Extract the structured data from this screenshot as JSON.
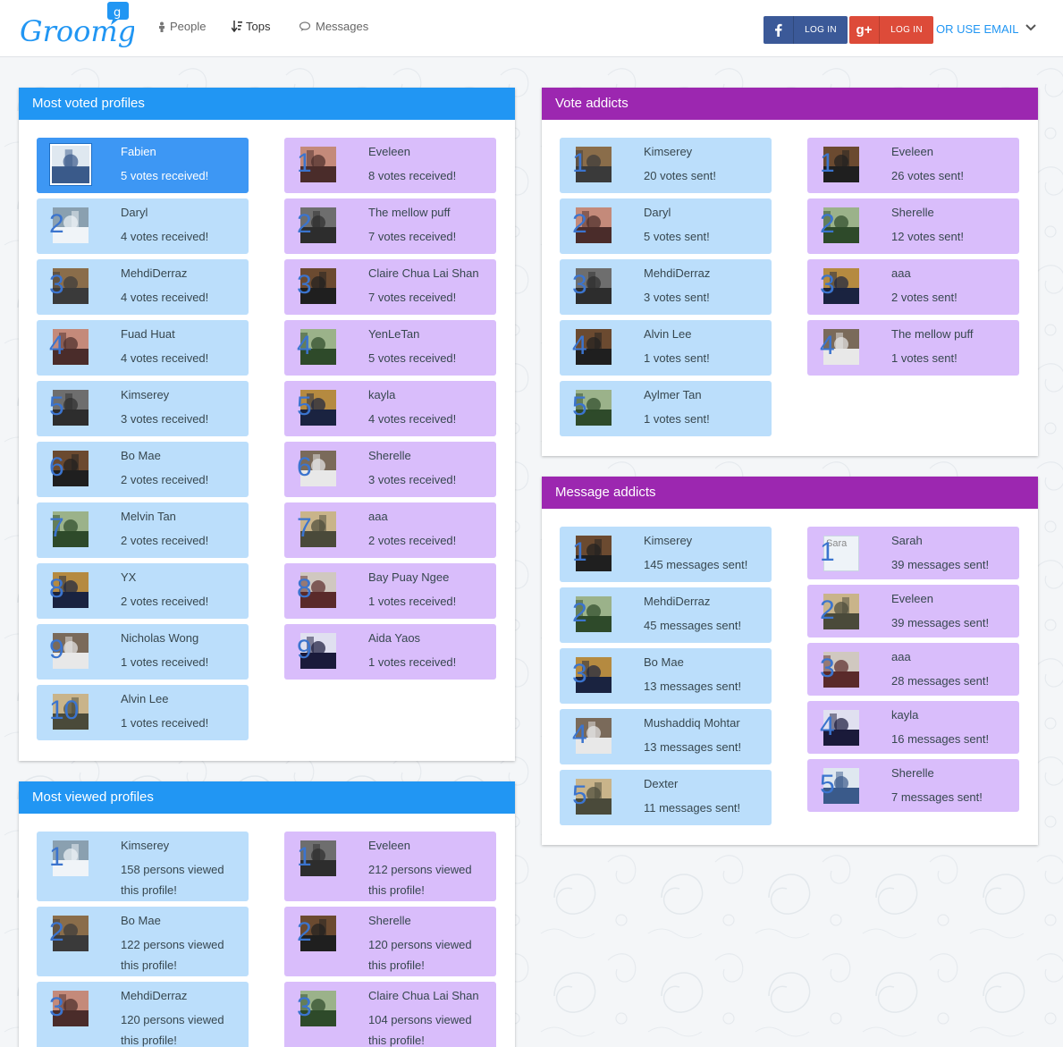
{
  "colors": {
    "blue": "#2196f3",
    "purple": "#9c27b0",
    "card_blue": "#bbdefb",
    "card_purple": "#d9bdfb",
    "selected": "#3d97f4"
  },
  "header": {
    "logo_text": "Groomgy",
    "nav": [
      {
        "label": "People",
        "icon": "person-icon"
      },
      {
        "label": "Tops",
        "icon": "sort-icon"
      },
      {
        "label": "Messages",
        "icon": "chat-icon"
      }
    ],
    "facebook_login": "LOG IN",
    "google_login": "LOG IN",
    "email_link": "OR USE EMAIL"
  },
  "most_voted": {
    "title": "Most voted profiles",
    "left": [
      {
        "rank": "1",
        "name": "Fabien",
        "count": "5 votes received!",
        "selected": true
      },
      {
        "rank": "2",
        "name": "Daryl",
        "count": "4 votes received!"
      },
      {
        "rank": "3",
        "name": "MehdiDerraz",
        "count": "4 votes received!"
      },
      {
        "rank": "4",
        "name": "Fuad Huat",
        "count": "4 votes received!"
      },
      {
        "rank": "5",
        "name": "Kimserey",
        "count": "3 votes received!"
      },
      {
        "rank": "6",
        "name": "Bo Mae",
        "count": "2 votes received!"
      },
      {
        "rank": "7",
        "name": "Melvin Tan",
        "count": "2 votes received!"
      },
      {
        "rank": "8",
        "name": "YX",
        "count": "2 votes received!"
      },
      {
        "rank": "9",
        "name": "Nicholas Wong",
        "count": "1 votes received!"
      },
      {
        "rank": "10",
        "name": "Alvin Lee",
        "count": "1 votes received!"
      }
    ],
    "right": [
      {
        "rank": "1",
        "name": "Eveleen",
        "count": "8 votes received!"
      },
      {
        "rank": "2",
        "name": "The mellow puff",
        "count": "7 votes received!"
      },
      {
        "rank": "3",
        "name": "Claire Chua Lai Shan",
        "count": "7 votes received!"
      },
      {
        "rank": "4",
        "name": "YenLeTan",
        "count": "5 votes received!"
      },
      {
        "rank": "5",
        "name": "kayla",
        "count": "4 votes received!"
      },
      {
        "rank": "6",
        "name": "Sherelle",
        "count": "3 votes received!"
      },
      {
        "rank": "7",
        "name": "aaa",
        "count": "2 votes received!"
      },
      {
        "rank": "8",
        "name": "Bay Puay Ngee",
        "count": "1 votes received!"
      },
      {
        "rank": "9",
        "name": "Aida Yaos",
        "count": "1 votes received!"
      }
    ]
  },
  "vote_addicts": {
    "title": "Vote addicts",
    "left": [
      {
        "rank": "1",
        "name": "Kimserey",
        "count": "20 votes sent!"
      },
      {
        "rank": "2",
        "name": "Daryl",
        "count": "5 votes sent!"
      },
      {
        "rank": "3",
        "name": "MehdiDerraz",
        "count": "3 votes sent!"
      },
      {
        "rank": "4",
        "name": "Alvin Lee",
        "count": "1 votes sent!"
      },
      {
        "rank": "5",
        "name": "Aylmer Tan",
        "count": "1 votes sent!"
      }
    ],
    "right": [
      {
        "rank": "1",
        "name": "Eveleen",
        "count": "26 votes sent!"
      },
      {
        "rank": "2",
        "name": "Sherelle",
        "count": "12 votes sent!"
      },
      {
        "rank": "3",
        "name": "aaa",
        "count": "2 votes sent!"
      },
      {
        "rank": "4",
        "name": "The mellow puff",
        "count": "1 votes sent!"
      }
    ]
  },
  "message_addicts": {
    "title": "Message addicts",
    "left": [
      {
        "rank": "1",
        "name": "Kimserey",
        "count": "145 messages sent!"
      },
      {
        "rank": "2",
        "name": "MehdiDerraz",
        "count": "45 messages sent!"
      },
      {
        "rank": "3",
        "name": "Bo Mae",
        "count": "13 messages sent!"
      },
      {
        "rank": "4",
        "name": "Mushaddiq Mohtar",
        "count": "13 messages sent!"
      },
      {
        "rank": "5",
        "name": "Dexter",
        "count": "11 messages sent!"
      }
    ],
    "right": [
      {
        "rank": "1",
        "name": "Sarah",
        "count": "39 messages sent!",
        "alt": "Sara"
      },
      {
        "rank": "2",
        "name": "Eveleen",
        "count": "39 messages sent!"
      },
      {
        "rank": "3",
        "name": "aaa",
        "count": "28 messages sent!"
      },
      {
        "rank": "4",
        "name": "kayla",
        "count": "16 messages sent!"
      },
      {
        "rank": "5",
        "name": "Sherelle",
        "count": "7 messages sent!"
      }
    ]
  },
  "most_viewed": {
    "title": "Most viewed profiles",
    "left": [
      {
        "rank": "1",
        "name": "Kimserey",
        "count": "158 persons viewed this profile!"
      },
      {
        "rank": "2",
        "name": "Bo Mae",
        "count": "122 persons viewed this profile!"
      },
      {
        "rank": "3",
        "name": "MehdiDerraz",
        "count": "120 persons viewed this profile!"
      }
    ],
    "right": [
      {
        "rank": "1",
        "name": "Eveleen",
        "count": "212 persons viewed this profile!"
      },
      {
        "rank": "2",
        "name": "Sherelle",
        "count": "120 persons viewed this profile!"
      },
      {
        "rank": "3",
        "name": "Claire Chua Lai Shan",
        "count": "104 persons viewed this profile!"
      }
    ]
  }
}
